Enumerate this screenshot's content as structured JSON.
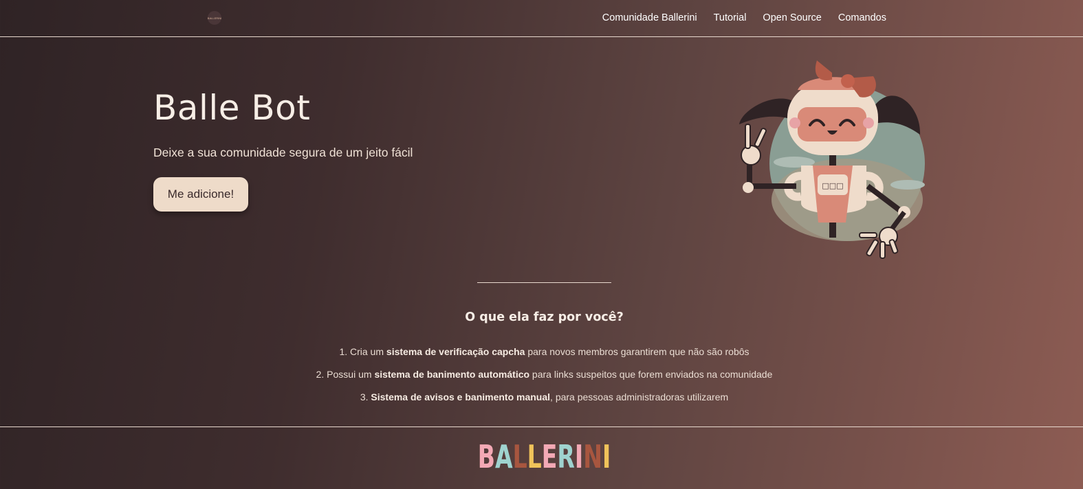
{
  "nav": {
    "logo_text": "BALLERINI",
    "links": [
      "Comunidade Ballerini",
      "Tutorial",
      "Open Source",
      "Comandos"
    ]
  },
  "hero": {
    "title": "Balle Bot",
    "subtitle": "Deixe a sua comunidade segura de um jeito fácil",
    "button_label": "Me adicione!",
    "robot_badge": "□□□"
  },
  "features": {
    "title": "O que ela faz por você?",
    "items": [
      {
        "prefix": "1. Cria um ",
        "bold": "sistema de verificação capcha",
        "suffix": " para novos membros garantirem que não são robôs"
      },
      {
        "prefix": "2. Possui um ",
        "bold": "sistema de banimento automático",
        "suffix": " para links suspeitos que forem enviados na comunidade"
      },
      {
        "prefix": "3. ",
        "bold": "Sistema de avisos e banimento manual",
        "suffix": ", para pessoas administradoras utilizarem"
      }
    ]
  },
  "footer": {
    "brand_letters": [
      "B",
      "A",
      "L",
      "L",
      "E",
      "R",
      "I",
      "N",
      "I"
    ],
    "brand_colors": [
      "#f3a9b5",
      "#9fd3cf",
      "#a8563f",
      "#f0c35a",
      "#f3a9b5",
      "#9fd3cf",
      "#f3a9b5",
      "#a8563f",
      "#f0c35a"
    ]
  }
}
